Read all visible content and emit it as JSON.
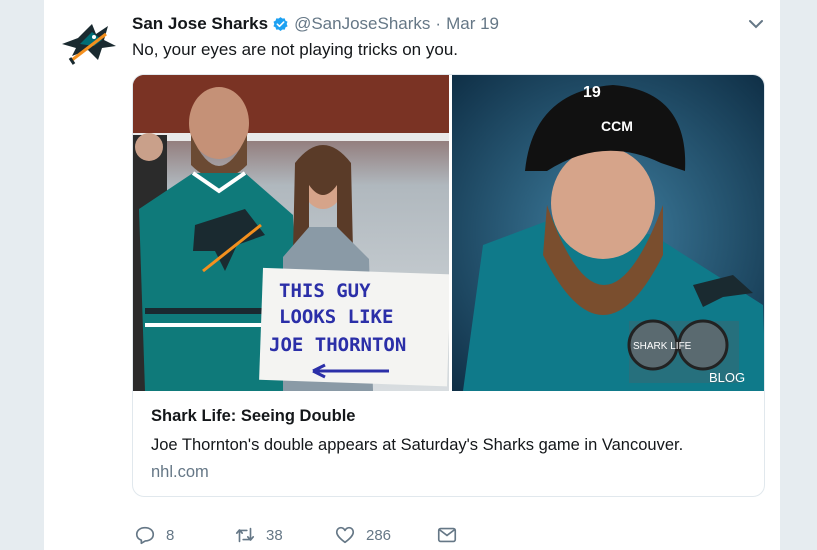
{
  "tweet": {
    "display_name": "San Jose Sharks",
    "handle": "@SanJoseSharks",
    "separator": "·",
    "date": "Mar 19",
    "text": "No, your eyes are not playing tricks on you.",
    "verified_icon": "verified-badge-icon",
    "caret_icon": "chevron-down-icon"
  },
  "card": {
    "image": {
      "sign_lines": [
        "THIS GUY",
        "LOOKS LIKE",
        "JOE THORNTON"
      ],
      "helmet_brand": "CCM",
      "helmet_number": "19",
      "logo_text": "SHARK LIFE",
      "logo_badge": "BLOG"
    },
    "title": "Shark Life: Seeing Double",
    "description": "Joe Thornton's double appears at Saturday's Sharks game in Vancouver.",
    "domain": "nhl.com"
  },
  "actions": {
    "reply_count": "8",
    "retweet_count": "38",
    "like_count": "286"
  },
  "colors": {
    "background": "#e6ecf0",
    "secondary_text": "#657786",
    "verified_blue": "#1da1f2",
    "sharks_teal": "#006d75"
  }
}
